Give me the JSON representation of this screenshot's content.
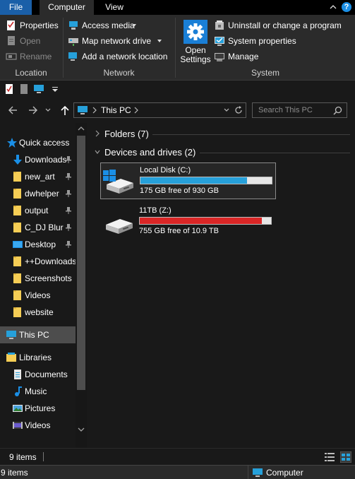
{
  "tabs": {
    "file": "File",
    "computer": "Computer",
    "view": "View",
    "help": "?"
  },
  "ribbon": {
    "location": {
      "title": "Location",
      "properties": "Properties",
      "open": "Open",
      "rename": "Rename"
    },
    "network": {
      "title": "Network",
      "access_media": "Access media",
      "map_network_drive": "Map network drive",
      "add_network_location": "Add a network location"
    },
    "system": {
      "title": "System",
      "open_settings_line1": "Open",
      "open_settings_line2": "Settings",
      "uninstall": "Uninstall or change a program",
      "system_properties": "System properties",
      "manage": "Manage"
    }
  },
  "address": {
    "path": "This PC",
    "search_placeholder": "Search This PC"
  },
  "nav": {
    "quick_access": "Quick access",
    "items": [
      {
        "label": "Downloads",
        "icon": "download-arrow-icon",
        "pinned": true
      },
      {
        "label": "new_art",
        "icon": "folder-icon",
        "pinned": true
      },
      {
        "label": "dwhelper",
        "icon": "folder-icon",
        "pinned": true
      },
      {
        "label": "output",
        "icon": "folder-icon",
        "pinned": true
      },
      {
        "label": "C_DJ Blur",
        "icon": "folder-icon",
        "pinned": true
      },
      {
        "label": "Desktop",
        "icon": "desktop-icon",
        "pinned": true
      },
      {
        "label": "++Downloads",
        "icon": "folder-icon",
        "pinned": false
      },
      {
        "label": "Screenshots",
        "icon": "folder-icon",
        "pinned": false
      },
      {
        "label": "Videos",
        "icon": "folder-icon",
        "pinned": false
      },
      {
        "label": "website",
        "icon": "folder-icon",
        "pinned": false
      }
    ],
    "this_pc": "This PC",
    "libraries": "Libraries",
    "library_items": [
      {
        "label": "Documents",
        "icon": "documents-icon"
      },
      {
        "label": "Music",
        "icon": "music-icon"
      },
      {
        "label": "Pictures",
        "icon": "pictures-icon"
      },
      {
        "label": "Videos",
        "icon": "videos-icon"
      }
    ]
  },
  "content": {
    "folders_header": "Folders (7)",
    "devices_header": "Devices and drives (2)",
    "drives": [
      {
        "name": "Local Disk (C:)",
        "free_text": "175 GB free of 930 GB",
        "used_fraction": 0.81,
        "bar_color": "#26a0da",
        "os_drive": true
      },
      {
        "name": "11TB (Z:)",
        "free_text": "755 GB free of 10.9 TB",
        "used_fraction": 0.93,
        "bar_color": "#da2626",
        "os_drive": false
      }
    ]
  },
  "status": {
    "item_count": "9 items"
  },
  "taskstrip": {
    "item_count": "9 items",
    "location": "Computer"
  },
  "colors": {
    "file_tab": "#1a5fa8",
    "ribbon_bg": "#2b2b2b",
    "window_bg": "#191919",
    "selection": "#4d4d4d",
    "accent_blue": "#26a0da",
    "warning_red": "#da2626"
  }
}
